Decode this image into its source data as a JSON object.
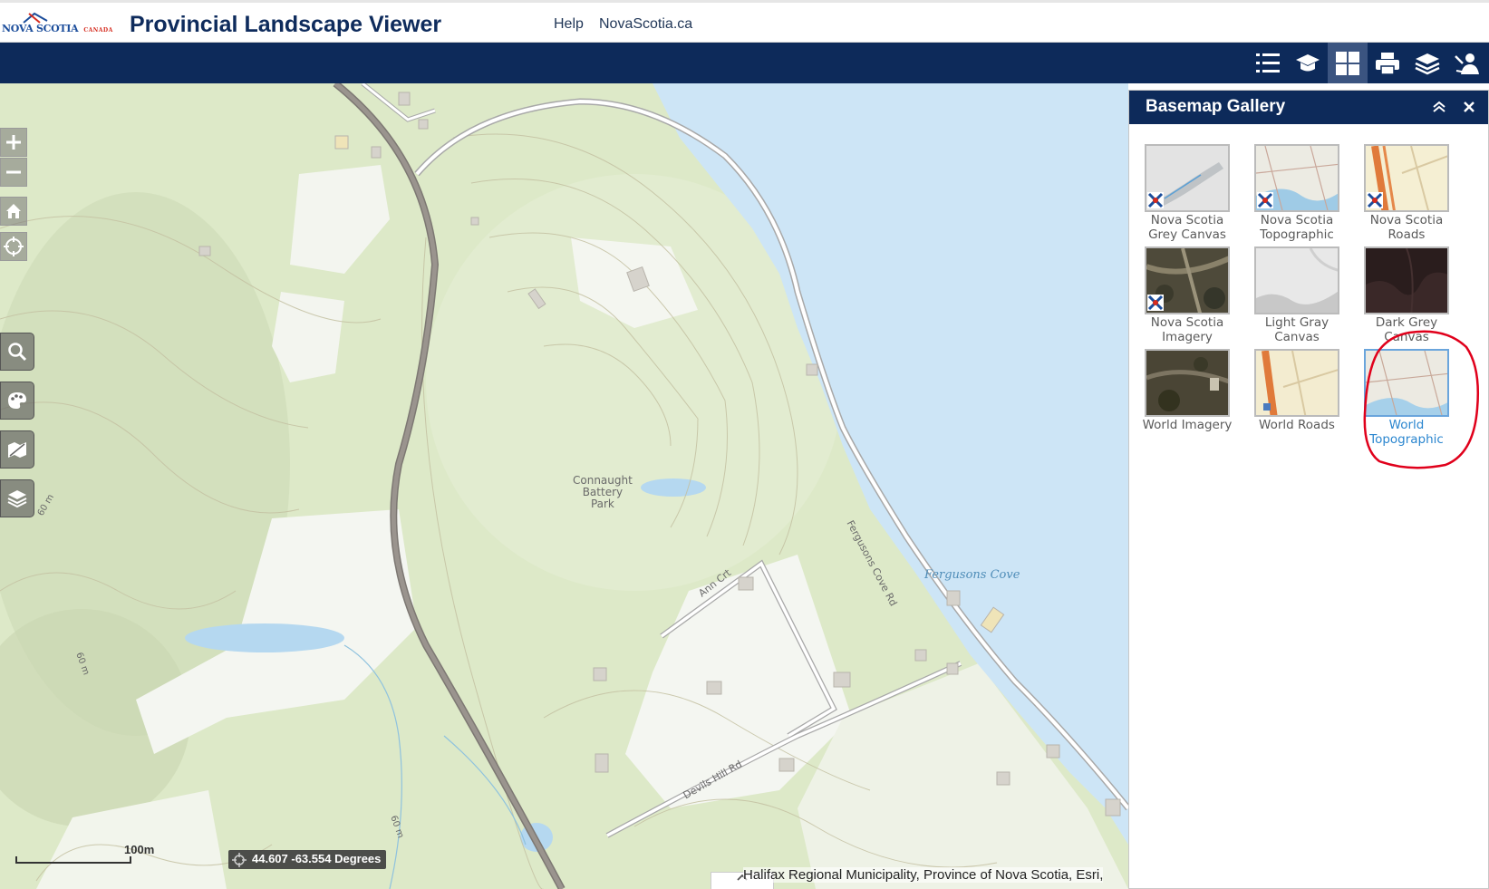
{
  "header": {
    "logo_text": "NOVA SCOTIA",
    "logo_subtext": "CANADA",
    "app_title": "Provincial Landscape Viewer",
    "links": [
      {
        "label": "Help"
      },
      {
        "label": "NovaScotia.ca"
      }
    ]
  },
  "toolbar": {
    "buttons": [
      {
        "icon": "legend-list-icon"
      },
      {
        "icon": "education-cap-icon"
      },
      {
        "icon": "basemap-grid-icon",
        "active": true
      },
      {
        "icon": "print-icon"
      },
      {
        "icon": "layers-add-icon"
      },
      {
        "icon": "identify-user-icon"
      }
    ]
  },
  "map": {
    "labels": {
      "park": [
        "Connaught",
        "Battery",
        "Park"
      ],
      "road_ann": "Ann Crt",
      "road_devils": "Devils Hill Rd",
      "road_fergusons": "Fergusons Cove Rd",
      "cove": "Fergusons Cove",
      "elev1": "60 m",
      "elev2": "60 m",
      "elev3": "60 m"
    },
    "scale_label": "100m",
    "coordinates": "44.607 -63.554 Degrees",
    "attribution": "Halifax Regional Municipality, Province of Nova Scotia, Esri,"
  },
  "panel": {
    "title": "Basemap Gallery",
    "basemaps": [
      {
        "label": [
          "Nova Scotia",
          "Grey Canvas"
        ],
        "ns": true
      },
      {
        "label": [
          "Nova Scotia",
          "Topographic"
        ],
        "ns": true
      },
      {
        "label": [
          "Nova Scotia",
          "Roads"
        ],
        "ns": true
      },
      {
        "label": [
          "Nova Scotia",
          "Imagery"
        ],
        "ns": true
      },
      {
        "label": [
          "Light Gray",
          "Canvas"
        ],
        "ns": false
      },
      {
        "label": [
          "Dark Grey",
          "Canvas"
        ],
        "ns": false
      },
      {
        "label": [
          "World Imagery"
        ],
        "ns": false
      },
      {
        "label": [
          "World Roads"
        ],
        "ns": false
      },
      {
        "label": [
          "World",
          "Topographic"
        ],
        "ns": false,
        "selected": true
      }
    ]
  },
  "colors": {
    "header_navy": "#0d2a5a",
    "water": "#cde5f6",
    "land": "#dde9c8",
    "selected_text": "#2b86cf",
    "annotation_red": "#e0001b"
  }
}
